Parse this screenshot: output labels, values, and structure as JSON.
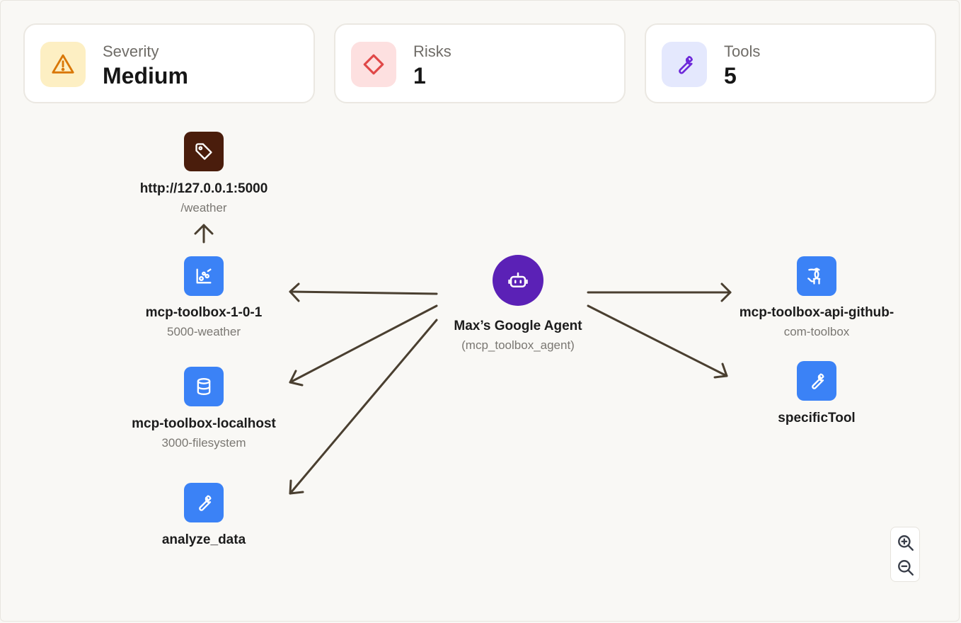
{
  "summary": {
    "severity": {
      "label": "Severity",
      "value": "Medium",
      "icon": "warning-triangle-icon"
    },
    "risks": {
      "label": "Risks",
      "value": "1",
      "icon": "diamond-icon"
    },
    "tools": {
      "label": "Tools",
      "value": "5",
      "icon": "wrench-icon"
    }
  },
  "graph": {
    "agent": {
      "title": "Max’s Google Agent",
      "subtitle": "(mcp_toolbox_agent)",
      "icon": "robot-icon"
    },
    "endpoint": {
      "title": "http://127.0.0.1:5000",
      "subtitle": "/weather",
      "icon": "tag-icon"
    },
    "left_nodes": [
      {
        "title": "mcp-toolbox-1-0-1",
        "subtitle": "5000-weather",
        "icon": "chart-scatter-icon"
      },
      {
        "title": "mcp-toolbox-localhost",
        "subtitle": "3000-filesystem",
        "icon": "database-icon"
      },
      {
        "title": "analyze_data",
        "subtitle": "",
        "icon": "wrench-icon"
      }
    ],
    "right_nodes": [
      {
        "title": "mcp-toolbox-api-github-",
        "subtitle": "com-toolbox",
        "icon": "github-icon"
      },
      {
        "title": "specificTool",
        "subtitle": "",
        "icon": "wrench-icon"
      }
    ]
  },
  "zoom": {
    "in_icon": "zoom-in-icon",
    "out_icon": "zoom-out-icon"
  },
  "colors": {
    "background": "#f9f8f5",
    "edge": "#4a3f30",
    "node_blue": "#3b82f6",
    "agent_purple": "#5b21b6",
    "endpoint_brown": "#4a1d0c",
    "severity_bg": "#fdefc3",
    "risks_bg": "#fde0e0",
    "tools_bg": "#e4e8fd"
  }
}
